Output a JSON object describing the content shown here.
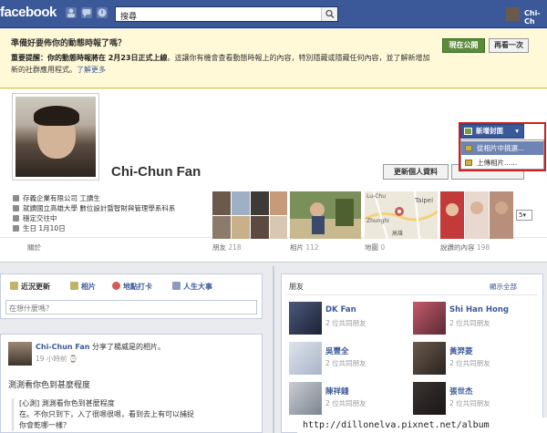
{
  "topbar": {
    "logo": "facebook",
    "search_placeholder": "搜尋",
    "username": "Chi-Ch",
    "icons": [
      "friend-requests-icon",
      "messages-icon",
      "notifications-icon",
      "search-icon"
    ]
  },
  "notice": {
    "title": "準備好要佈你的動態時報了嗎？",
    "body_bold": "重要提醒：你的動態時報將在 2月23日正式上線",
    "body_rest": "。這讓你有機會查看動態時報上的內容，特別隱藏或隱藏任何內容，並了解新增加新的社群應用程式。",
    "learn_more": "了解更多",
    "publish_label": "現在公開",
    "later_label": "再看一次"
  },
  "profile": {
    "name": "Chi-Chun Fan",
    "edit_label": "更新個人資料",
    "cover_label": "新增封面",
    "cover_menu": [
      "從相片中挑選...",
      "上傳相片......"
    ],
    "info": [
      "存義企業有限公司 工讀生",
      "就讀國立高雄大學 數位設計暨智財與管理學系科系",
      "穩定交往中",
      "生日 1月10日"
    ],
    "about": "關於",
    "more_dropdown": "5",
    "tabs": [
      {
        "label": "朋友",
        "count": "218"
      },
      {
        "label": "相片",
        "count": "112"
      },
      {
        "label": "地圖",
        "count": "0"
      },
      {
        "label": "說讚的內容",
        "count": "198"
      }
    ],
    "map_labels": [
      "Lu-Chu",
      "Taipei",
      "Zhunghi",
      "高雄"
    ]
  },
  "composer": {
    "tabs": [
      "近況更新",
      "相片",
      "地點打卡",
      "人生大事"
    ],
    "placeholder": "在想什麼嗎？"
  },
  "post": {
    "author": "Chi-Chun Fan",
    "action": "分享了楊威是的相片。",
    "time": "19 小時前",
    "text": "測測看你色到甚麼程度",
    "quote_line1": "[心測] 測測看你色到甚麼程度",
    "quote_line2": "在。不你只到下，入了很嗯很嗯，看到去上有可以捕捉",
    "quote_line3": "你會乾哪一樣？"
  },
  "friends": {
    "title": "朋友",
    "see_all": "顯示全部",
    "list": [
      {
        "name": "DK Fan",
        "mutual": "2 位共同朋友"
      },
      {
        "name": "Shi Han Hong",
        "mutual": "2 位共同朋友"
      },
      {
        "name": "吳豐全",
        "mutual": "2 位共同朋友"
      },
      {
        "name": "黃羿菱",
        "mutual": "2 位共同朋友"
      },
      {
        "name": "陳祥錢",
        "mutual": "2 位共同朋友"
      },
      {
        "name": "張世杰",
        "mutual": "2 位共同朋友"
      }
    ]
  },
  "watermark": "http://dillonelva.pixnet.net/album",
  "colors": {
    "brand": "#3b5998",
    "notice_bg": "#fff9d7",
    "highlight": "#d01f1f"
  }
}
